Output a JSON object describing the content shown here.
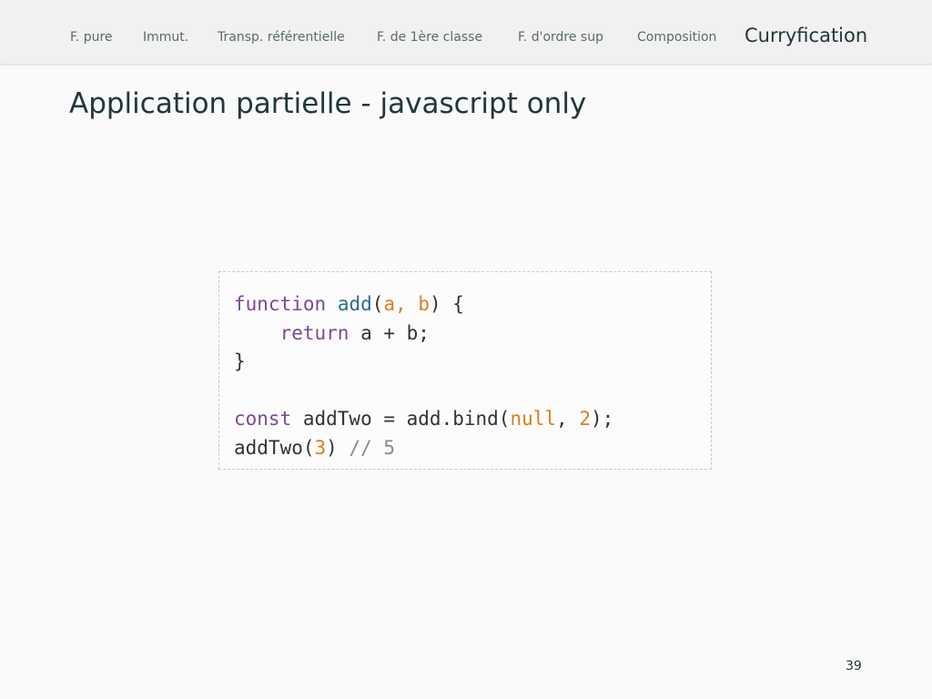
{
  "nav": {
    "items": [
      {
        "label": "F. pure"
      },
      {
        "label": "Immut."
      },
      {
        "label": "Transp. référentielle"
      },
      {
        "label": "F. de 1ère classe"
      },
      {
        "label": "F. d'ordre sup"
      },
      {
        "label": "Composition"
      },
      {
        "label": "Curryfication"
      }
    ],
    "active": "Curryfication"
  },
  "slide": {
    "title": "Application partielle - javascript only",
    "page_number": "39"
  },
  "code": {
    "line1": {
      "keyword": "function",
      "space": " ",
      "fn_name": "add",
      "open": "(",
      "params": "a, b",
      "close": ") {"
    },
    "line2": {
      "indent": "    ",
      "keyword": "return",
      "rest": " a + b;"
    },
    "line3": {
      "text": "}"
    },
    "line5": {
      "keyword": "const",
      "mid": " addTwo = add.bind(",
      "null": "null",
      "sep": ", ",
      "arg": "2",
      "end": ");"
    },
    "line6": {
      "call": "addTwo(",
      "arg": "3",
      "close": ") ",
      "comment": "// 5"
    }
  },
  "colors": {
    "keyword": "#7a4a95",
    "function_name": "#2c6a8e",
    "literal": "#d9801f",
    "comment": "#8a8a8a",
    "title": "#23373b",
    "navbar_bg": "#f1f1f1"
  }
}
